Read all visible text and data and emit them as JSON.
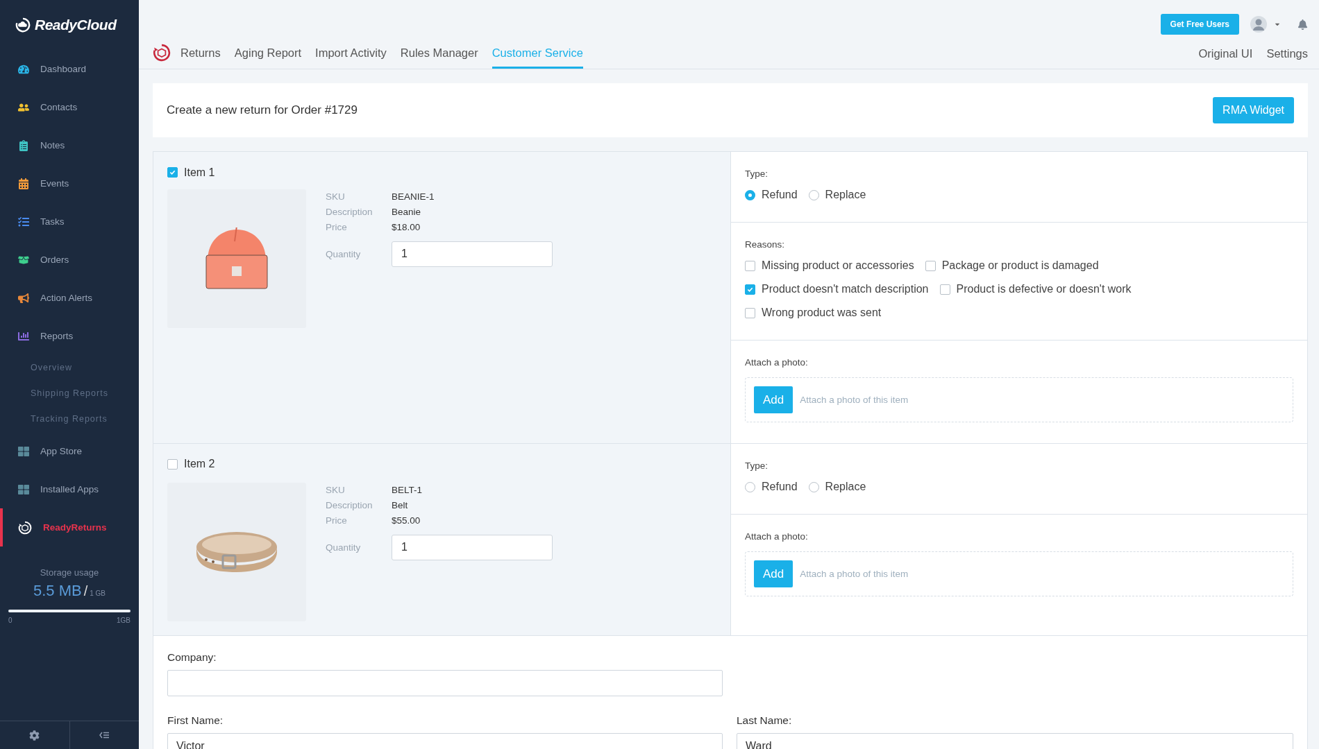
{
  "sidebar": {
    "logo": "ReadyCloud",
    "items": [
      {
        "label": "Dashboard",
        "selected": false
      },
      {
        "label": "Contacts",
        "selected": false
      },
      {
        "label": "Notes",
        "selected": false
      },
      {
        "label": "Events",
        "selected": false
      },
      {
        "label": "Tasks",
        "selected": false
      },
      {
        "label": "Orders",
        "selected": false
      },
      {
        "label": "Action Alerts",
        "selected": false
      },
      {
        "label": "Reports",
        "selected": false,
        "children": [
          {
            "label": "Overview"
          },
          {
            "label": "Shipping Reports"
          },
          {
            "label": "Tracking Reports"
          }
        ]
      },
      {
        "label": "App Store",
        "selected": false
      },
      {
        "label": "Installed Apps",
        "selected": false
      },
      {
        "label": "ReadyReturns",
        "selected": true
      }
    ],
    "storage": {
      "label": "Storage usage",
      "used": "5.5 MB",
      "separator": "/",
      "total": "1 GB",
      "level": 1,
      "min": "0",
      "max": "1GB"
    }
  },
  "header": {
    "button": "Get Free Users",
    "tabs": [
      {
        "label": "Returns",
        "selected": false
      },
      {
        "label": "Aging Report",
        "selected": false
      },
      {
        "label": "Import Activity",
        "selected": false
      },
      {
        "label": "Rules Manager",
        "selected": false
      },
      {
        "label": "Customer Service",
        "selected": true
      }
    ],
    "links": [
      "Original UI",
      "Settings"
    ]
  },
  "title": "Create a new return for Order #1729",
  "title_button": "RMA Widget",
  "items": [
    {
      "label": "Item 1",
      "checked": true,
      "fields": [
        {
          "label": "SKU",
          "value": "BEANIE-1"
        },
        {
          "label": "Description",
          "value": "Beanie"
        },
        {
          "label": "Price",
          "value": "$18.00"
        }
      ],
      "quantity": {
        "label": "Quantity",
        "value": "1"
      },
      "type": {
        "label": "Type:",
        "options": [
          {
            "label": "Refund",
            "selected": true
          },
          {
            "label": "Replace",
            "selected": false
          }
        ]
      },
      "reasons": {
        "label": "Reasons:",
        "options": [
          {
            "label": "Missing product or accessories",
            "checked": false
          },
          {
            "label": "Package or product is damaged",
            "checked": false
          },
          {
            "label": "Product doesn't match description",
            "checked": true
          },
          {
            "label": "Product is defective or doesn't work",
            "checked": false
          },
          {
            "label": "Wrong product was sent",
            "checked": false
          }
        ]
      },
      "photo": {
        "label": "Attach a photo:",
        "button": "Add",
        "placeholder": "Attach a photo of this item"
      }
    },
    {
      "label": "Item 2",
      "checked": false,
      "fields": [
        {
          "label": "SKU",
          "value": "BELT-1"
        },
        {
          "label": "Description",
          "value": "Belt"
        },
        {
          "label": "Price",
          "value": "$55.00"
        }
      ],
      "quantity": {
        "label": "Quantity",
        "value": "1"
      },
      "type": {
        "label": "Type:",
        "options": [
          {
            "label": "Refund",
            "selected": false
          },
          {
            "label": "Replace",
            "selected": false
          }
        ]
      },
      "photo": {
        "label": "Attach a photo:",
        "button": "Add",
        "placeholder": "Attach a photo of this item"
      }
    }
  ],
  "form": {
    "company": {
      "label": "Company:"
    },
    "first_name": {
      "label": "First Name:",
      "value": "Victor"
    },
    "last_name": {
      "label": "Last Name:",
      "value": "Ward"
    }
  }
}
